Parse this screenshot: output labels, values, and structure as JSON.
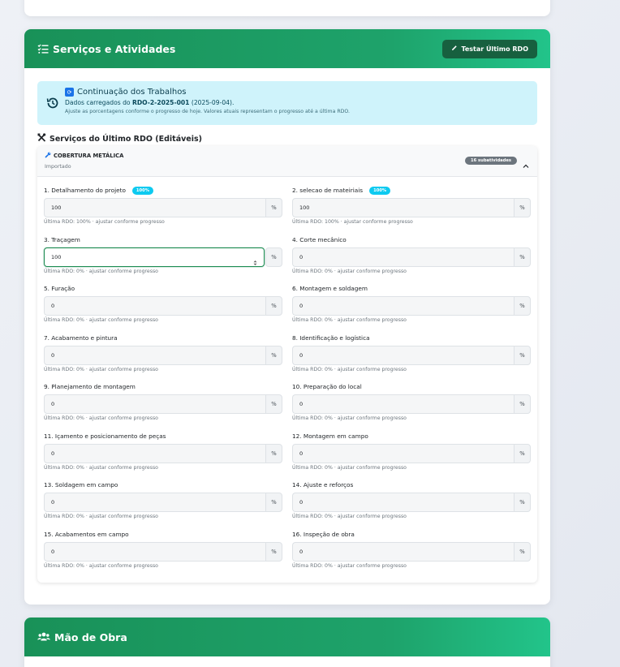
{
  "services": {
    "header_title": "Serviços e Atividades",
    "test_button_label": "Testar Último RDO",
    "alert": {
      "title": "Continuação dos Trabalhos",
      "line_prefix": "Dados carregados do ",
      "rdo_code": "RDO-2-2025-001",
      "rdo_date": " (2025-09-04).",
      "hint": "Ajuste as porcentagens conforme o progresso de hoje. Valores atuais representam o progresso até a última RDO."
    },
    "section_title": "Serviços do Último RDO (Editáveis)",
    "group": {
      "name": "COBERTURA METÁLICA",
      "sub": "Importado",
      "badge": "16 subatividades"
    },
    "unit": "%",
    "items": [
      {
        "label": "1. Detalhamento do projeto",
        "badge": "100%",
        "value": "100",
        "help": "Última RDO: 100% · ajustar conforme progresso"
      },
      {
        "label": "2. selecao de mateiriais",
        "badge": "100%",
        "value": "100",
        "help": "Última RDO: 100% · ajustar conforme progresso"
      },
      {
        "label": "3. Traçagem",
        "badge": "",
        "value": "100",
        "help": "Última RDO: 0% · ajustar conforme progresso"
      },
      {
        "label": "4. Corte mecânico",
        "badge": "",
        "value": "0",
        "help": "Última RDO: 0% · ajustar conforme progresso"
      },
      {
        "label": "5. Furação",
        "badge": "",
        "value": "0",
        "help": "Última RDO: 0% · ajustar conforme progresso"
      },
      {
        "label": "6. Montagem e soldagem",
        "badge": "",
        "value": "0",
        "help": "Última RDO: 0% · ajustar conforme progresso"
      },
      {
        "label": "7. Acabamento e pintura",
        "badge": "",
        "value": "0",
        "help": "Última RDO: 0% · ajustar conforme progresso"
      },
      {
        "label": "8. Identificação e logística",
        "badge": "",
        "value": "0",
        "help": "Última RDO: 0% · ajustar conforme progresso"
      },
      {
        "label": "9. Planejamento de montagem",
        "badge": "",
        "value": "0",
        "help": "Última RDO: 0% · ajustar conforme progresso"
      },
      {
        "label": "10. Preparação do local",
        "badge": "",
        "value": "0",
        "help": "Última RDO: 0% · ajustar conforme progresso"
      },
      {
        "label": "11. Içamento e posicionamento de peças",
        "badge": "",
        "value": "0",
        "help": "Última RDO: 0% · ajustar conforme progresso"
      },
      {
        "label": "12. Montagem em campo",
        "badge": "",
        "value": "0",
        "help": "Última RDO: 0% · ajustar conforme progresso"
      },
      {
        "label": "13. Soldagem em campo",
        "badge": "",
        "value": "0",
        "help": "Última RDO: 0% · ajustar conforme progresso"
      },
      {
        "label": "14. Ajuste e reforços",
        "badge": "",
        "value": "0",
        "help": "Última RDO: 0% · ajustar conforme progresso"
      },
      {
        "label": "15. Acabamentos em campo",
        "badge": "",
        "value": "0",
        "help": "Última RDO: 0% · ajustar conforme progresso"
      },
      {
        "label": "16. Inspeção de obra",
        "badge": "",
        "value": "0",
        "help": "Última RDO: 0% · ajustar conforme progresso"
      }
    ],
    "focused_index": 2
  },
  "labor": {
    "header_title": "Mão de Obra"
  },
  "colors": {
    "header_green": "#199158",
    "accent_cyan": "#0dcaf0",
    "alert_bg": "#cff3fb"
  },
  "icons": [
    "tasks-icon",
    "pencil-icon",
    "history-icon",
    "refresh-icon",
    "tools-icon",
    "wrench-icon",
    "chevron-up-icon",
    "spinner-icon",
    "users-icon"
  ]
}
